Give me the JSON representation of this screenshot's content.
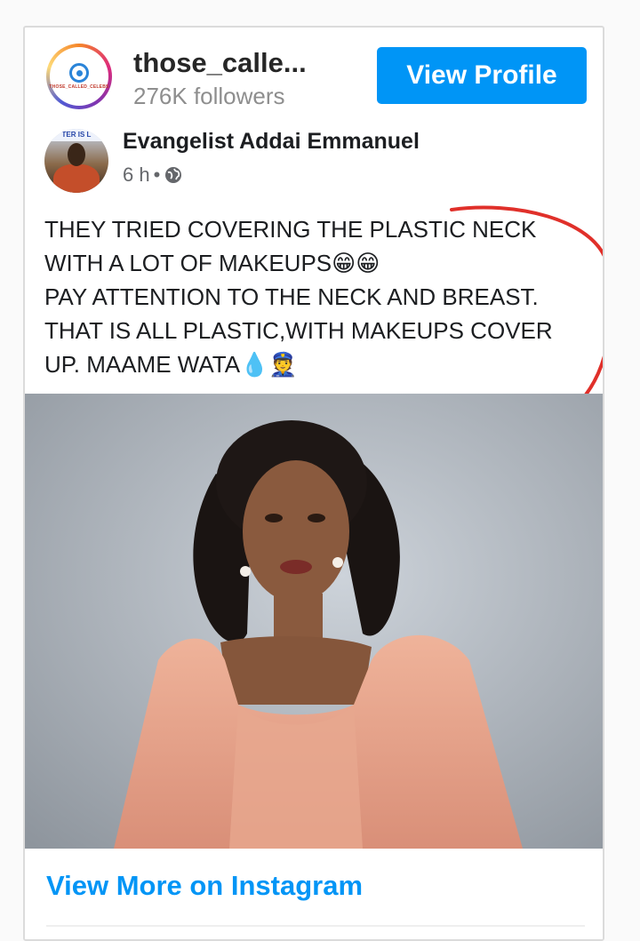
{
  "instagram": {
    "username": "those_calle...",
    "followers": "276K followers",
    "avatar_text": "THOSE_CALLED_CELEBS",
    "view_profile_label": "View Profile",
    "view_more_label": "View More on Instagram"
  },
  "facebook_post": {
    "author": "Evangelist Addai Emmanuel",
    "time": "6 h",
    "separator": "•",
    "visibility_icon": "globe-icon",
    "avatar_banner": "TER IS L",
    "text_lines": [
      "THEY TRIED COVERING THE PLASTIC NECK",
      "WITH A LOT OF MAKEUPS😁😁",
      "PAY ATTENTION TO THE NECK AND BREAST.",
      "THAT IS ALL PLASTIC,WITH MAKEUPS COVER",
      "UP. MAAME WATA💧👮"
    ]
  },
  "colors": {
    "accent": "#0095f6",
    "annotation_red": "#e0302a",
    "dress": "#e8a48c"
  }
}
